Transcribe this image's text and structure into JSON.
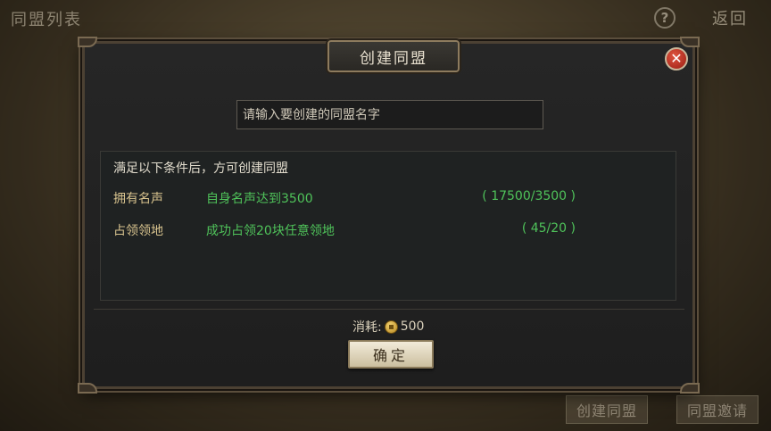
{
  "screen": {
    "title": "同盟列表",
    "help_icon": "?",
    "back_label": "返回",
    "bottom_buttons": {
      "create": "创建同盟",
      "invite": "同盟邀请"
    }
  },
  "dialog": {
    "title": "创建同盟",
    "close_icon": "✕",
    "name_input_placeholder": "请输入要创建的同盟名字",
    "requirements_heading": "满足以下条件后，方可创建同盟",
    "requirements": [
      {
        "label": "拥有名声",
        "description": "自身名声达到3500",
        "progress": "( 17500/3500 )",
        "current": 17500,
        "required": 3500
      },
      {
        "label": "占领领地",
        "description": "成功占领20块任意领地",
        "progress": "( 45/20 )",
        "current": 45,
        "required": 20
      }
    ],
    "cost_label": "消耗:",
    "cost_value": "500",
    "confirm_label": "确定"
  },
  "colors": {
    "requirement_met": "#4fc35a",
    "label_gold": "#d8c38e",
    "close_red": "#c0281a"
  },
  "icons": {
    "close": "close-icon",
    "coin": "coin-icon",
    "help": "help-icon"
  }
}
